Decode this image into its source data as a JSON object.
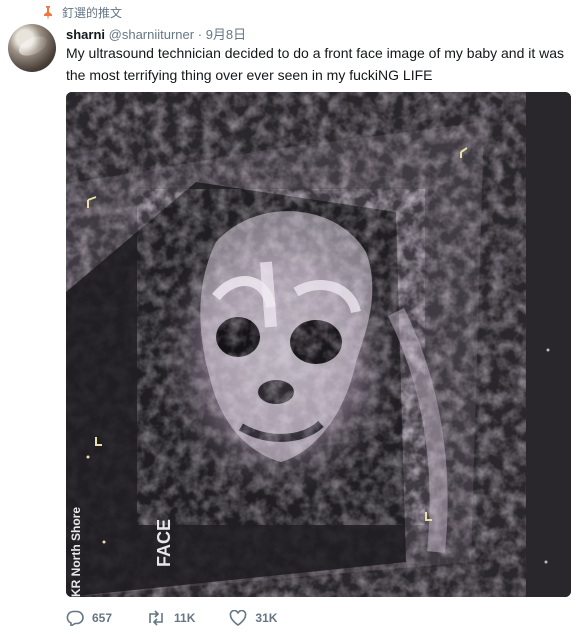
{
  "tweet": {
    "pinned_label": "釘選的推文",
    "author_name": "sharni",
    "author_handle": "@sharniiturner",
    "separator": "·",
    "date": "9月8日",
    "text": "My ultrasound technician decided to do a front face image of my baby and it was the most terrifying thing over ever seen in my fuckiNG LIFE"
  },
  "media": {
    "image_text_face": "FACE",
    "image_text_hospital": "KR North Shore"
  },
  "actions": {
    "reply_count": "657",
    "retweet_count": "11K",
    "like_count": "31K"
  },
  "icons": {
    "pin": "pin-icon",
    "reply": "reply-icon",
    "retweet": "retweet-icon",
    "like": "heart-icon"
  },
  "colors": {
    "pin_accent": "#f2763e",
    "meta_gray": "#657786",
    "text": "#14171a"
  }
}
